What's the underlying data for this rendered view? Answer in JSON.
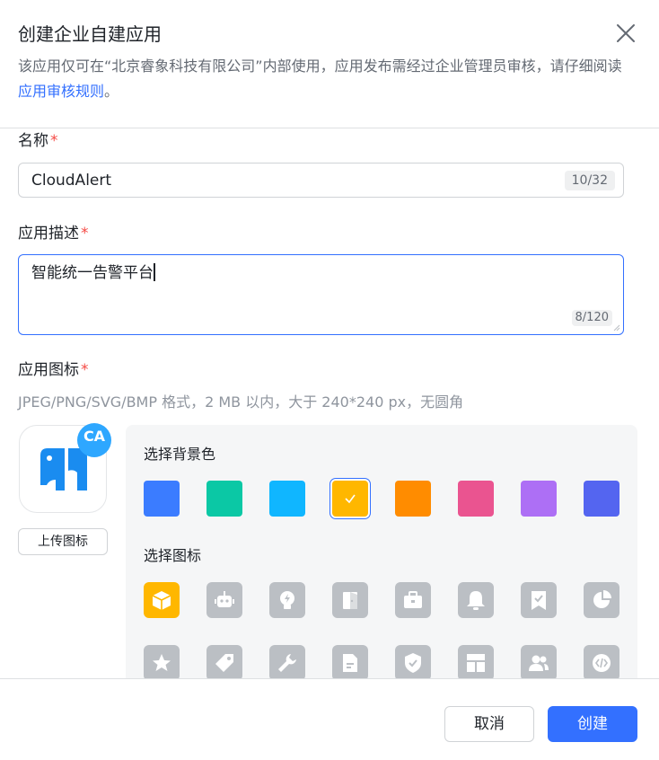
{
  "dialog": {
    "title": "创建企业自建应用",
    "subtitle": "该应用仅可在“北京睿象科技有限公司”内部使用，应用发布需经过企业管理员审核，请仔细阅读",
    "rules_link": "应用审核规则",
    "subtitle_end": "。"
  },
  "name_field": {
    "label": "名称",
    "required_mark": "*",
    "value": "CloudAlert",
    "counter": "10/32"
  },
  "desc_field": {
    "label": "应用描述",
    "required_mark": "*",
    "value": "智能统一告警平台",
    "counter": "8/120"
  },
  "icon_field": {
    "label": "应用图标",
    "required_mark": "*",
    "hint": "JPEG/PNG/SVG/BMP 格式，2 MB 以内，大于 240*240 px，无圆角",
    "badge_text": "CA",
    "upload_label": "上传图标"
  },
  "colors": {
    "accent": "#3370ff",
    "icon_tile_gray": "#bbbfc4",
    "selected_icon_bg": "#ffb700",
    "app_icon_blue": "#1a8cf0",
    "badge_blue": "#2ea7ff"
  },
  "bg_picker": {
    "title": "选择背景色",
    "swatches": [
      {
        "color": "#3b7cff",
        "selected": false
      },
      {
        "color": "#0bc8a5",
        "selected": false
      },
      {
        "color": "#10b6ff",
        "selected": false
      },
      {
        "color": "#ffb700",
        "selected": true
      },
      {
        "color": "#ff8c00",
        "selected": false
      },
      {
        "color": "#ea5490",
        "selected": false
      },
      {
        "color": "#ad6ff5",
        "selected": false
      },
      {
        "color": "#5465f0",
        "selected": false
      }
    ]
  },
  "icon_picker": {
    "title": "选择图标",
    "row1": [
      "cube-icon",
      "robot-icon",
      "lightbulb-icon",
      "door-icon",
      "briefcase-icon",
      "bell-icon",
      "bookmark-check-icon",
      "pie-chart-icon"
    ],
    "row2": [
      "star-icon",
      "tag-icon",
      "wrench-icon",
      "document-icon",
      "shield-check-icon",
      "layout-icon",
      "users-icon",
      "code-icon"
    ],
    "selected_index": 0
  },
  "footer": {
    "cancel_label": "取消",
    "create_label": "创建"
  }
}
